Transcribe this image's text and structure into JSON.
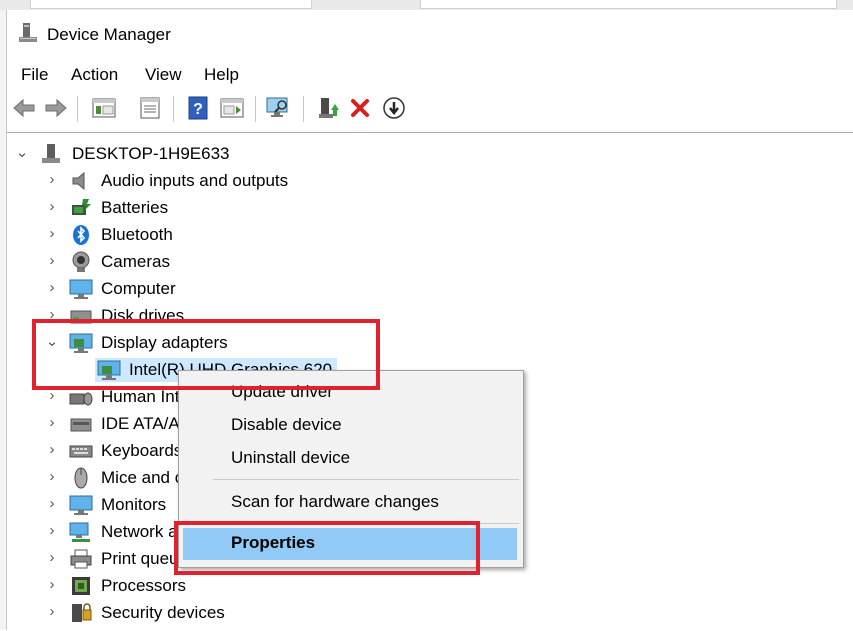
{
  "window": {
    "title": "Device Manager"
  },
  "menu": [
    "File",
    "Action",
    "View",
    "Help"
  ],
  "toolbar": [
    "back-icon",
    "forward-icon",
    "show-hide-tree-icon",
    "properties-icon",
    "help-icon",
    "action-pane-icon",
    "scan-hardware-icon",
    "update-driver-icon",
    "uninstall-icon",
    "disable-icon"
  ],
  "tree": {
    "root": "DESKTOP-1H9E633",
    "items": [
      {
        "label": "Audio inputs and outputs",
        "icon": "speaker-icon"
      },
      {
        "label": "Batteries",
        "icon": "battery-icon"
      },
      {
        "label": "Bluetooth",
        "icon": "bluetooth-icon"
      },
      {
        "label": "Cameras",
        "icon": "camera-icon"
      },
      {
        "label": "Computer",
        "icon": "computer-icon"
      },
      {
        "label": "Disk drives",
        "icon": "disk-icon"
      },
      {
        "label": "Display adapters",
        "icon": "display-adapter-icon",
        "expanded": true
      },
      {
        "label": "Intel(R) UHD Graphics 620",
        "icon": "display-adapter-icon",
        "child": true,
        "selected": true
      },
      {
        "label": "Human Interface Devices",
        "icon": "hid-icon"
      },
      {
        "label": "IDE ATA/ATAPI controllers",
        "icon": "ide-icon"
      },
      {
        "label": "Keyboards",
        "icon": "keyboard-icon"
      },
      {
        "label": "Mice and other pointing devices",
        "icon": "mouse-icon"
      },
      {
        "label": "Monitors",
        "icon": "monitor-icon"
      },
      {
        "label": "Network adapters",
        "icon": "network-icon"
      },
      {
        "label": "Print queues",
        "icon": "printer-icon"
      },
      {
        "label": "Processors",
        "icon": "processor-icon"
      },
      {
        "label": "Security devices",
        "icon": "security-icon"
      }
    ]
  },
  "context_menu": {
    "items": [
      {
        "label": "Update driver"
      },
      {
        "label": "Disable device"
      },
      {
        "label": "Uninstall device"
      },
      {
        "separator": true
      },
      {
        "label": "Scan for hardware changes"
      },
      {
        "separator": true
      },
      {
        "label": "Properties",
        "highlighted": true
      }
    ]
  },
  "colors": {
    "highlight_box": "#e0212e",
    "selection": "#cde8ff",
    "menu_hover": "#91c9f7"
  }
}
